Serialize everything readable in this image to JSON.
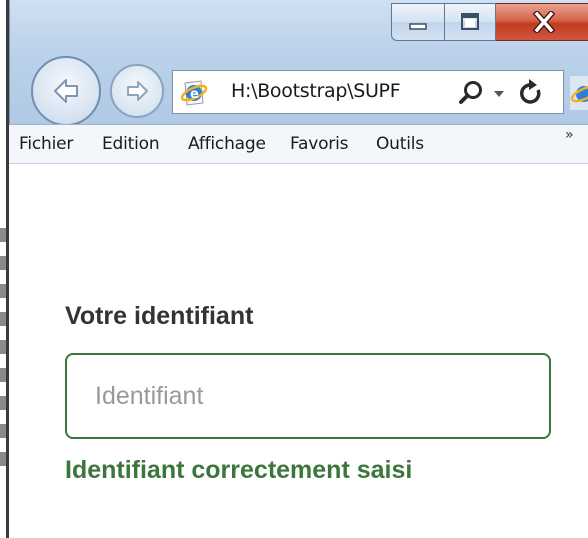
{
  "window": {
    "caption_buttons": {
      "minimize_icon": "minimize-icon",
      "maximize_icon": "maximize-icon",
      "close_icon": "close-icon"
    }
  },
  "navigation": {
    "back_icon": "back-arrow-icon",
    "forward_icon": "forward-arrow-icon",
    "address": "H:\\Bootstrap\\SUPF",
    "search_icon": "search-icon",
    "dropdown_icon": "chevron-down-icon",
    "refresh_icon": "refresh-icon"
  },
  "menubar": {
    "items": [
      "Fichier",
      "Edition",
      "Affichage",
      "Favoris",
      "Outils"
    ],
    "overflow": "»"
  },
  "form": {
    "label": "Votre identifiant",
    "input_placeholder": "Identifiant",
    "input_value": "",
    "help_text": "Identifiant correctement saisi"
  },
  "colors": {
    "success": "#3c763d",
    "label_text": "#333333",
    "placeholder": "#999999",
    "chrome_blue": "#bcd2ea",
    "close_red": "#c13b1f"
  }
}
